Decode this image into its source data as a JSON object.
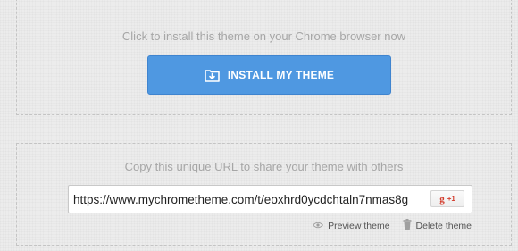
{
  "install_section": {
    "caption": "Click to install this theme on your Chrome browser now",
    "button_label": "INSTALL MY THEME",
    "button_icon": "folder-download-icon"
  },
  "share_section": {
    "caption": "Copy this unique URL to share your theme with others",
    "url_value": "https://www.mychrometheme.com/t/eoxhrd0ycdchtaln7nmas8g",
    "gplus_logo": "g",
    "gplus_count": "+1",
    "preview_label": "Preview theme",
    "preview_icon": "eye-icon",
    "delete_label": "Delete theme",
    "delete_icon": "trash-icon"
  },
  "colors": {
    "background": "#ececec",
    "button": "#4f98e1",
    "caption_text": "#a6a6a6",
    "gplus_red": "#d33b2b"
  }
}
